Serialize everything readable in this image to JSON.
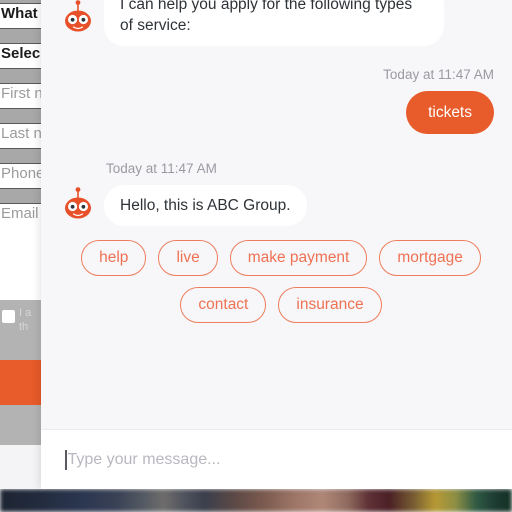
{
  "background_page": {
    "name": "application-form-behind-widget",
    "fields": [
      {
        "label": "What",
        "style": "dark"
      },
      {
        "label": "Selec",
        "style": "dark"
      },
      {
        "label": "First n",
        "style": "muted"
      },
      {
        "label": "Last n",
        "style": "muted"
      },
      {
        "label": "Phone",
        "style": "muted"
      },
      {
        "label": "Email",
        "style": "muted"
      }
    ],
    "consent": {
      "line1": "I a",
      "line2": "th"
    },
    "submit_button_color": "#e85b2a"
  },
  "chat": {
    "panel_background": "#f7f7f9",
    "accent_color": "#e85b2a",
    "chip_color": "#ef7153",
    "messages": [
      {
        "id": "bot-intro",
        "sender": "bot",
        "text": "I can help you apply for the following types of service:"
      },
      {
        "id": "user-tickets",
        "sender": "user",
        "text": "tickets",
        "timestamp": "Today at 11:47 AM"
      },
      {
        "id": "bot-greeting",
        "sender": "bot",
        "text": "Hello, this is ABC Group.",
        "timestamp": "Today at 11:47 AM"
      }
    ],
    "quick_replies": [
      "help",
      "live",
      "make payment",
      "mortgage",
      "contact",
      "insurance"
    ],
    "composer": {
      "placeholder": "Type your message...",
      "value": ""
    },
    "avatar_icon": "robot-avatar-icon"
  }
}
